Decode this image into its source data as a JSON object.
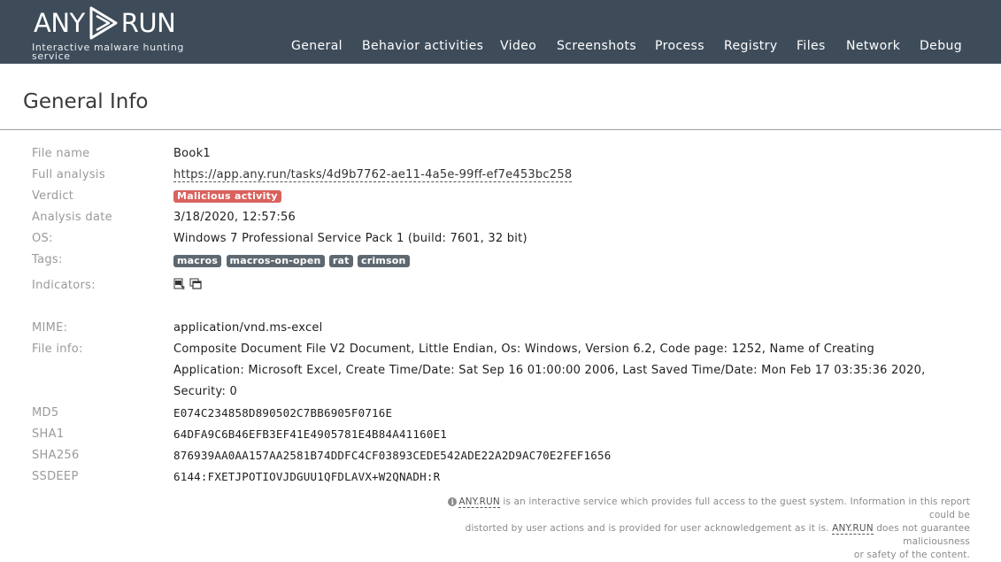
{
  "header": {
    "logo_left": "ANY",
    "logo_right": "RUN",
    "tagline": "Interactive malware hunting service",
    "nav": [
      "General",
      "Behavior activities",
      "Video",
      "Screenshots",
      "Process",
      "Registry",
      "Files",
      "Network",
      "Debug"
    ]
  },
  "page_title": "General Info",
  "general": {
    "file_name_label": "File name",
    "file_name": "Book1",
    "full_analysis_label": "Full analysis",
    "full_analysis": "https://app.any.run/tasks/4d9b7762-ae11-4a5e-99ff-ef7e453bc258",
    "verdict_label": "Verdict",
    "verdict": "Malicious activity",
    "analysis_date_label": "Analysis date",
    "analysis_date": "3/18/2020, 12:57:56",
    "os_label": "OS:",
    "os": "Windows 7 Professional Service Pack 1 (build: 7601, 32 bit)",
    "tags_label": "Tags:",
    "tags": [
      "macros",
      "macros-on-open",
      "rat",
      "crimson"
    ],
    "indicators_label": "Indicators:",
    "indicator_icons": [
      "document-macro-icon",
      "windows-icon"
    ]
  },
  "details": {
    "mime_label": "MIME:",
    "mime": "application/vnd.ms-excel",
    "file_info_label": "File info:",
    "file_info_lines": [
      "Composite Document File V2 Document, Little Endian, Os: Windows, Version 6.2, Code page: 1252, Name of Creating",
      "Application: Microsoft Excel, Create Time/Date: Sat Sep 16 01:00:00 2006, Last Saved Time/Date: Mon Feb 17 03:35:36 2020,",
      "Security: 0"
    ],
    "md5_label": "MD5",
    "md5": "E074C234858D890502C7BB6905F0716E",
    "sha1_label": "SHA1",
    "sha1": "64DFA9C6B46EFB3EF41E4905781E4B84A41160E1",
    "sha256_label": "SHA256",
    "sha256": "876939AA0AA157AA2581B74DDFC4CF03893CEDE542ADE22A2D9AC70E2FEF1656",
    "ssdeep_label": "SSDEEP",
    "ssdeep": "6144:FXETJPOTIOVJDGUU1QFDLAVX+W2QNADH:R"
  },
  "footer": {
    "brand": "ANY.RUN",
    "text1": " is an interactive service which provides full access to the guest system. Information in this report could be",
    "text2": "distorted by user actions and is provided for user acknowledgement as it is. ",
    "text3": " does not guarantee maliciousness",
    "text4": "or safety of the content."
  },
  "colors": {
    "header_bg": "#3e4c5a",
    "verdict_badge": "#d9625d",
    "tag_badge": "#5e6871"
  }
}
